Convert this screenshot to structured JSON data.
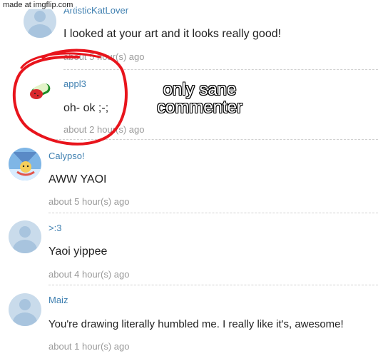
{
  "watermark": "made at imgflip.com",
  "annotation": {
    "line1": "only sane",
    "line2": "commenter"
  },
  "comments": [
    {
      "username": "ArtisticKatLover",
      "text": "I looked at your art and it looks really good!",
      "time": "about 5 hour(s) ago",
      "avatar": "default-avatar"
    },
    {
      "username": "appl3",
      "text": "oh- ok ;-;",
      "time": "about 2 hour(s) ago",
      "avatar": "watermelon-avatar"
    },
    {
      "username": "Calypso!",
      "text": "AWW YAOI",
      "time": "about 5 hour(s) ago",
      "avatar": "anime-avatar"
    },
    {
      "username": ">:3",
      "text": "Yaoi yippee",
      "time": "about 4 hour(s) ago",
      "avatar": "default-avatar"
    },
    {
      "username": "Maiz",
      "text": "You're drawing literally humbled me. I really like it's, awesome!",
      "time": "about 1 hour(s) ago",
      "avatar": "default-avatar"
    }
  ],
  "colors": {
    "username": "#3e7fb0",
    "time": "#9a9a9a",
    "circle": "#e8141c"
  }
}
